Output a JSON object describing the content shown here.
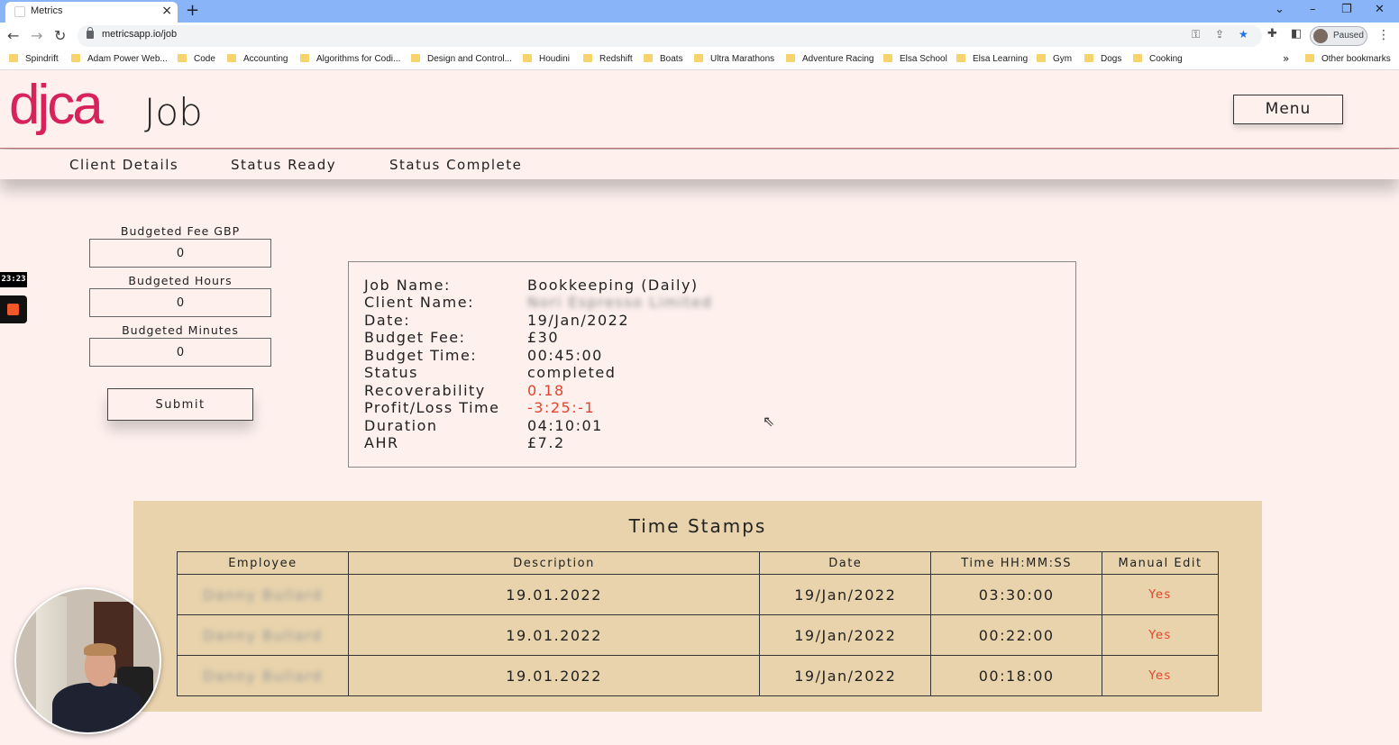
{
  "browser": {
    "tab_title": "Metrics",
    "tab_close": "×",
    "new_tab": "+",
    "url": "metricsapp.io/job",
    "profile_status": "Paused",
    "bookmarks": [
      "Spindrift",
      "Adam Power Web...",
      "Code",
      "Accounting",
      "Algorithms for Codi...",
      "Design and Control...",
      "Houdini",
      "Redshift",
      "Boats",
      "Ultra Marathons",
      "Adventure Racing",
      "Elsa School",
      "Elsa Learning",
      "Gym",
      "Dogs",
      "Cooking"
    ],
    "bookmarks_more": "»",
    "other_bookmarks": "Other bookmarks",
    "folder_color": "#f7d36b"
  },
  "header": {
    "logo": "djca",
    "title": "Job",
    "menu_label": "Menu",
    "brand_color": "#d7225c"
  },
  "subnav": [
    "Client Details",
    "Status Ready",
    "Status Complete"
  ],
  "form": {
    "budgeted_fee_label": "Budgeted Fee GBP",
    "budgeted_fee_value": "0",
    "budgeted_hours_label": "Budgeted Hours",
    "budgeted_hours_value": "0",
    "budgeted_minutes_label": "Budgeted Minutes",
    "budgeted_minutes_value": "0",
    "submit_label": "Submit"
  },
  "recorder": {
    "time": "23:23"
  },
  "job_info": {
    "rows": [
      {
        "key": "Job Name:",
        "value": "Bookkeeping (Daily)"
      },
      {
        "key": "Client Name:",
        "value": "Nori Espresso Limited"
      },
      {
        "key": "Date:",
        "value": "19/Jan/2022"
      },
      {
        "key": "Budget Fee:",
        "value": "£30"
      },
      {
        "key": "Budget Time:",
        "value": "00:45:00"
      },
      {
        "key": "Status",
        "value": "completed"
      },
      {
        "key": "Recoverability",
        "value": "0.18"
      },
      {
        "key": "Profit/Loss Time",
        "value": "-3:25:-1"
      },
      {
        "key": "Duration",
        "value": "04:10:01"
      },
      {
        "key": "AHR",
        "value": "£7.2"
      }
    ],
    "highlight_color": "#e2452b"
  },
  "timestamps": {
    "title": "Time Stamps",
    "columns": [
      "Employee",
      "Description",
      "Date",
      "Time HH:MM:SS",
      "Manual Edit"
    ],
    "rows": [
      [
        "Danny Bullard",
        "19.01.2022",
        "19/Jan/2022",
        "03:30:00",
        "Yes"
      ],
      [
        "Danny Bullard",
        "19.01.2022",
        "19/Jan/2022",
        "00:22:00",
        "Yes"
      ],
      [
        "Danny Bullard",
        "19.01.2022",
        "19/Jan/2022",
        "00:18:00",
        "Yes"
      ]
    ],
    "panel_color": "#e8d3ac"
  }
}
